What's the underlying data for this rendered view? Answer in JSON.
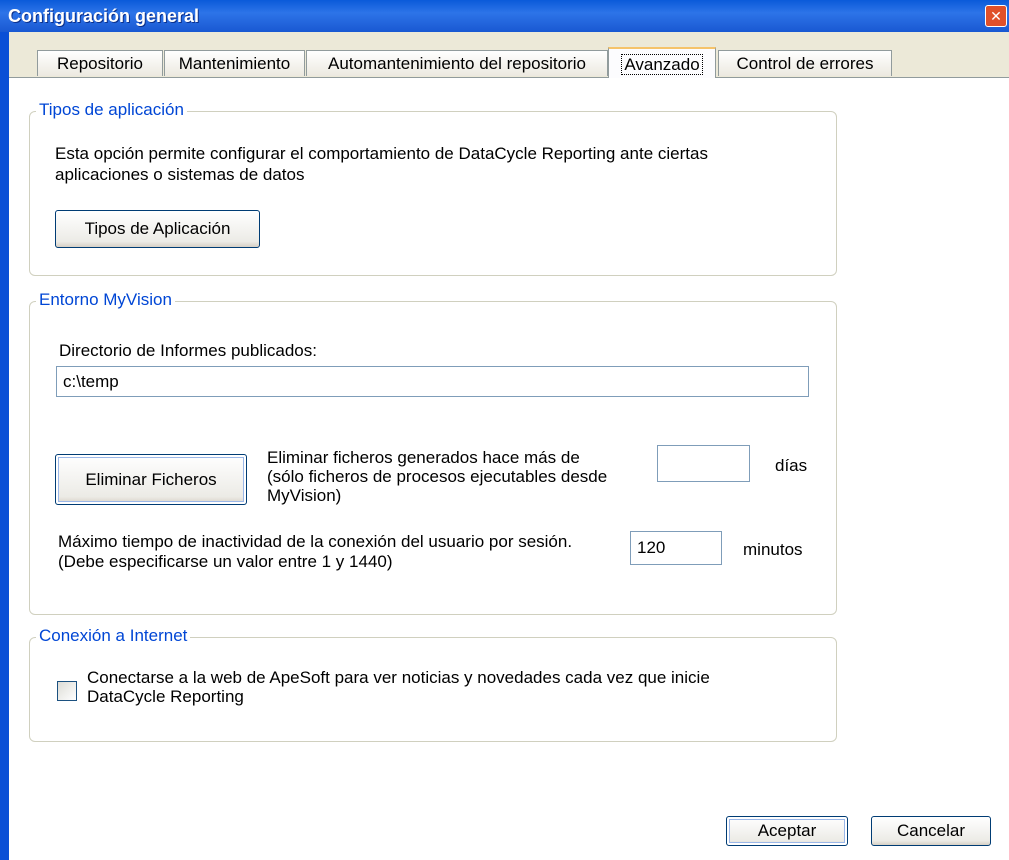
{
  "window": {
    "title": "Configuración general",
    "close_symbol": "✕"
  },
  "tabs": [
    {
      "label": "Repositorio",
      "active": false
    },
    {
      "label": "Mantenimiento",
      "active": false
    },
    {
      "label": "Automantenimiento del repositorio",
      "active": false
    },
    {
      "label": "Avanzado",
      "active": true
    },
    {
      "label": "Control de errores",
      "active": false
    }
  ],
  "app_types": {
    "group_title": "Tipos de aplicación",
    "description_line1": "Esta opción permite configurar el comportamiento de DataCycle Reporting ante ciertas",
    "description_line2": "aplicaciones o sistemas de datos",
    "button_label": "Tipos de Aplicación"
  },
  "myvision": {
    "group_title": "Entorno MyVision",
    "directory_label": "Directorio de Informes publicados:",
    "directory_value": "c:\\temp",
    "delete_button_label": "Eliminar Ficheros",
    "delete_text_line1": "Eliminar ficheros generados hace más de",
    "delete_text_line2": "(sólo ficheros de procesos ejecutables desde",
    "delete_text_line3": "MyVision)",
    "days_value": "",
    "days_unit": "días",
    "inactivity_line1": "Máximo tiempo de inactividad de la conexión del usuario por sesión.",
    "inactivity_line2": "(Debe especificarse un valor entre 1 y 1440)",
    "inactivity_value": "120",
    "inactivity_unit": "minutos"
  },
  "internet": {
    "group_title": "Conexión a Internet",
    "checkbox_line1": "Conectarse a la web de ApeSoft para ver noticias y novedades cada vez que inicie",
    "checkbox_line2": "DataCycle Reporting",
    "checked": false
  },
  "footer": {
    "accept_label": "Aceptar",
    "cancel_label": "Cancelar"
  }
}
